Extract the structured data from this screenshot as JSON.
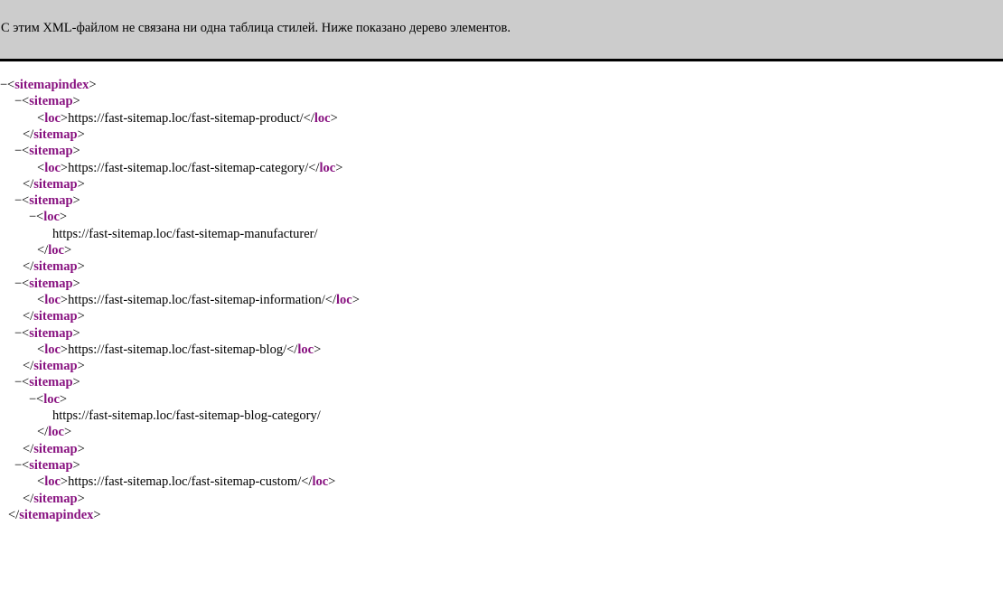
{
  "header": {
    "message": "С этим XML-файлом не связана ни одна таблица стилей. Ниже показано дерево элементов."
  },
  "tree": {
    "root_tag": "sitemapindex",
    "child_tag": "sitemap",
    "loc_tag": "loc",
    "collapse_symbol": "−",
    "open_bracket": "<",
    "close_bracket": ">",
    "end_open_bracket": "</",
    "sitemaps": [
      {
        "loc": "https://fast-sitemap.loc/fast-sitemap-product/",
        "loc_expanded": false
      },
      {
        "loc": "https://fast-sitemap.loc/fast-sitemap-category/",
        "loc_expanded": false
      },
      {
        "loc": "https://fast-sitemap.loc/fast-sitemap-manufacturer/",
        "loc_expanded": true
      },
      {
        "loc": "https://fast-sitemap.loc/fast-sitemap-information/",
        "loc_expanded": false
      },
      {
        "loc": "https://fast-sitemap.loc/fast-sitemap-blog/",
        "loc_expanded": false
      },
      {
        "loc": "https://fast-sitemap.loc/fast-sitemap-blog-category/",
        "loc_expanded": true
      },
      {
        "loc": "https://fast-sitemap.loc/fast-sitemap-custom/",
        "loc_expanded": false
      }
    ]
  },
  "colors": {
    "header_bg": "#cccccc",
    "tag_name": "#881280",
    "text": "#000000"
  }
}
